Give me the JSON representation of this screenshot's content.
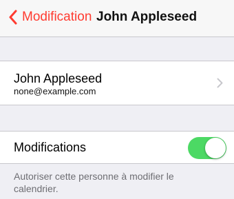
{
  "navbar": {
    "back_label": "Modification",
    "title": "John Appleseed",
    "back_icon": "chevron-left-icon",
    "accent_color": "#ff3b30"
  },
  "contact": {
    "name": "John Appleseed",
    "email": "none@example.com",
    "disclosure_icon": "chevron-right-icon"
  },
  "settings": {
    "modifications_label": "Modifications",
    "modifications_enabled": true,
    "switch_on_color": "#4cd964",
    "footer_note": "Autoriser cette personne à modifier le calendrier."
  }
}
